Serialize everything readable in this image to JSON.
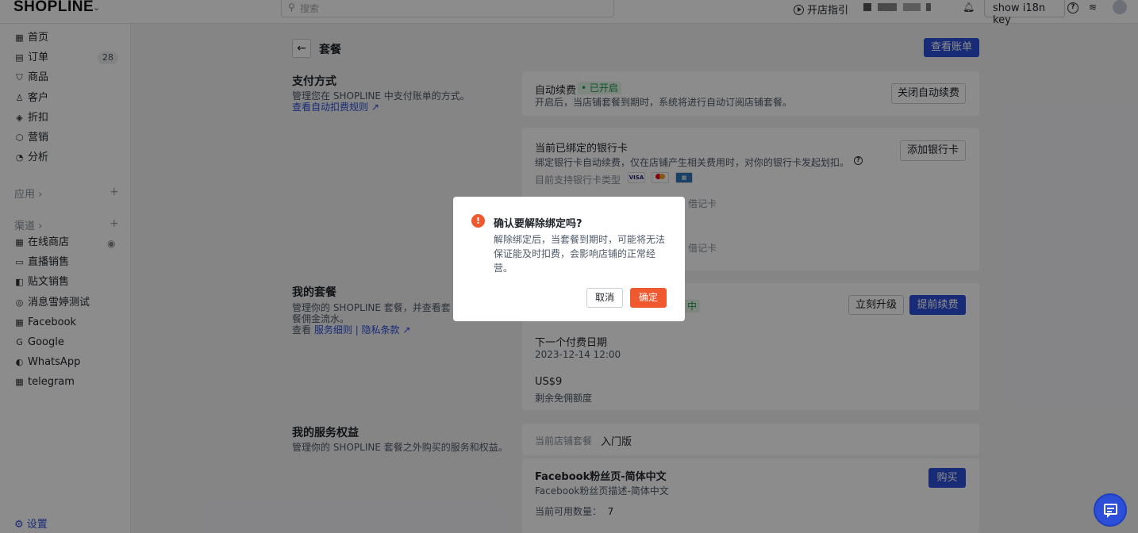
{
  "topbar": {
    "logo": "SHOPLINE",
    "search_placeholder": "搜索",
    "guide_label": "开店指引",
    "i18n_label": "show i18n key"
  },
  "sidebar": {
    "items": [
      {
        "label": "首页",
        "icon": "home-icon",
        "glyph": "▦"
      },
      {
        "label": "订单",
        "icon": "order-icon",
        "glyph": "▤",
        "badge": "28"
      },
      {
        "label": "商品",
        "icon": "product-icon",
        "glyph": "⛉"
      },
      {
        "label": "客户",
        "icon": "customer-icon",
        "glyph": "♙"
      },
      {
        "label": "折扣",
        "icon": "discount-icon",
        "glyph": "◈"
      },
      {
        "label": "营销",
        "icon": "marketing-icon",
        "glyph": "⬡"
      },
      {
        "label": "分析",
        "icon": "analytics-icon",
        "glyph": "◔"
      }
    ],
    "apps_label": "应用",
    "channels_label": "渠道",
    "channels": [
      {
        "label": "在线商店",
        "icon": "online-store-icon",
        "glyph": "▦"
      },
      {
        "label": "直播销售",
        "icon": "live-sales-icon",
        "glyph": "▭"
      },
      {
        "label": "贴文销售",
        "icon": "post-sales-icon",
        "glyph": "◧"
      },
      {
        "label": "消息雪婷测试",
        "icon": "message-icon",
        "glyph": "◎"
      },
      {
        "label": "Facebook",
        "icon": "facebook-icon",
        "glyph": "▦"
      },
      {
        "label": "Google",
        "icon": "google-icon",
        "glyph": "G"
      },
      {
        "label": "WhatsApp",
        "icon": "whatsapp-icon",
        "glyph": "◐"
      },
      {
        "label": "telegram",
        "icon": "telegram-icon",
        "glyph": "▦"
      }
    ],
    "settings_label": "设置"
  },
  "page": {
    "title": "套餐",
    "view_bill": "查看账单"
  },
  "payment": {
    "title": "支付方式",
    "desc": "管理您在 SHOPLINE 中支付账单的方式。",
    "rules_link": "查看自动扣费规则",
    "auto_renew_label": "自动续费",
    "auto_renew_status": "• 已开启",
    "auto_renew_desc": "开启后，当店铺套餐到期时，系统将进行自动订阅店铺套餐。",
    "close_auto_renew": "关闭自动续费",
    "bound_card_title": "当前已绑定的银行卡",
    "bound_card_desc": "绑定银行卡自动续费，仅在店铺产生相关费用时，对你的银行卡发起划扣。",
    "supported_types": "目前支持银行卡类型",
    "add_card": "添加银行卡",
    "debit_1": "借记卡",
    "debit_2": "借记卡"
  },
  "plan": {
    "title": "我的套餐",
    "desc": "管理你的 SHOPLINE 套餐，并查看套餐佣金流水。",
    "view_prefix": "查看",
    "service_terms": "服务细则",
    "privacy": "隐私条款",
    "status_fragment": "中",
    "upgrade": "立刻升级",
    "renew": "提前续费",
    "next_payment_label": "下一个付费日期",
    "next_payment_value": "2023-12-14 12:00",
    "amount": "US$9",
    "amount_label": "剩余免佣额度"
  },
  "services": {
    "title": "我的服务权益",
    "desc": "管理你的 SHOPLINE 套餐之外购买的服务和权益。",
    "current_plan_label": "当前店铺套餐",
    "current_plan_value": "入门版",
    "item_title": "Facebook粉丝页-简体中文",
    "item_desc": "Facebook粉丝页描述-简体中文",
    "available_label": "当前可用数量：",
    "available_value": "7",
    "buy": "购买"
  },
  "modal": {
    "title": "确认要解除绑定吗?",
    "body": "解除绑定后，当套餐到期时，可能将无法保证能及时扣费，会影响店铺的正常经营。",
    "cancel": "取消",
    "confirm": "确定"
  },
  "colors": {
    "primary": "#2d4fd8",
    "danger": "#f0582f",
    "success": "#1c9b4c"
  }
}
